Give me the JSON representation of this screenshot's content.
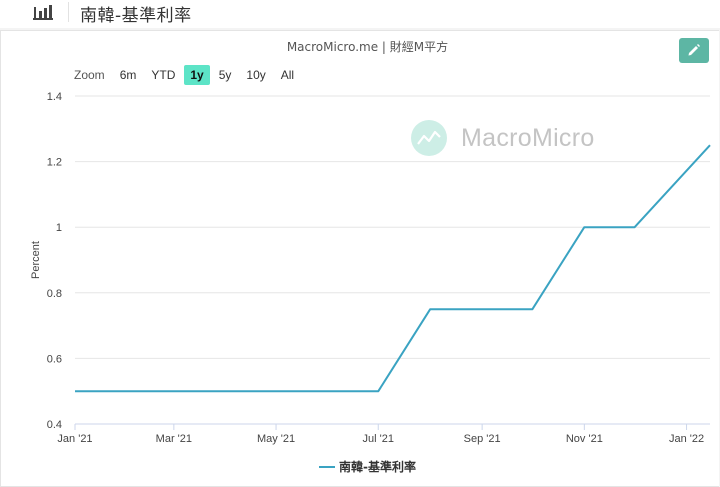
{
  "header": {
    "title": "南韓-基準利率",
    "icon": "bar-chart-icon"
  },
  "credits": "MacroMicro.me | 財經M平方",
  "edit_icon": "pencil-icon",
  "zoom": {
    "label": "Zoom",
    "options": [
      "6m",
      "YTD",
      "1y",
      "5y",
      "10y",
      "All"
    ],
    "selected": "1y"
  },
  "watermark": "MacroMicro",
  "colors": {
    "accent": "#5db6a4",
    "zoom_active": "#5de4c7",
    "series": "#3aa3c2"
  },
  "chart_data": {
    "type": "line",
    "title": "",
    "xlabel": "",
    "ylabel": "Percent",
    "ylim": [
      0.4,
      1.4
    ],
    "yticks": [
      0.4,
      0.6,
      0.8,
      1,
      1.2,
      1.4
    ],
    "ytick_labels": [
      "0.4",
      "0.6",
      "0.8",
      "1",
      "1.2",
      "1.4"
    ],
    "xlim": [
      "2021-01-01",
      "2022-01-15"
    ],
    "xticks": [
      "2021-01-01",
      "2021-03-01",
      "2021-05-01",
      "2021-07-01",
      "2021-09-01",
      "2021-11-01",
      "2022-01-01"
    ],
    "xtick_labels": [
      "Jan '21",
      "Mar '21",
      "May '21",
      "Jul '21",
      "Sep '21",
      "Nov '21",
      "Jan '22"
    ],
    "grid": true,
    "legend": "bottom-center",
    "series": [
      {
        "name": "南韓-基準利率",
        "color": "#3aa3c2",
        "points": [
          [
            "2021-01-01",
            0.5
          ],
          [
            "2021-07-01",
            0.5
          ],
          [
            "2021-08-01",
            0.75
          ],
          [
            "2021-10-01",
            0.75
          ],
          [
            "2021-11-01",
            1.0
          ],
          [
            "2021-12-01",
            1.0
          ],
          [
            "2022-01-15",
            1.25
          ]
        ]
      }
    ]
  }
}
